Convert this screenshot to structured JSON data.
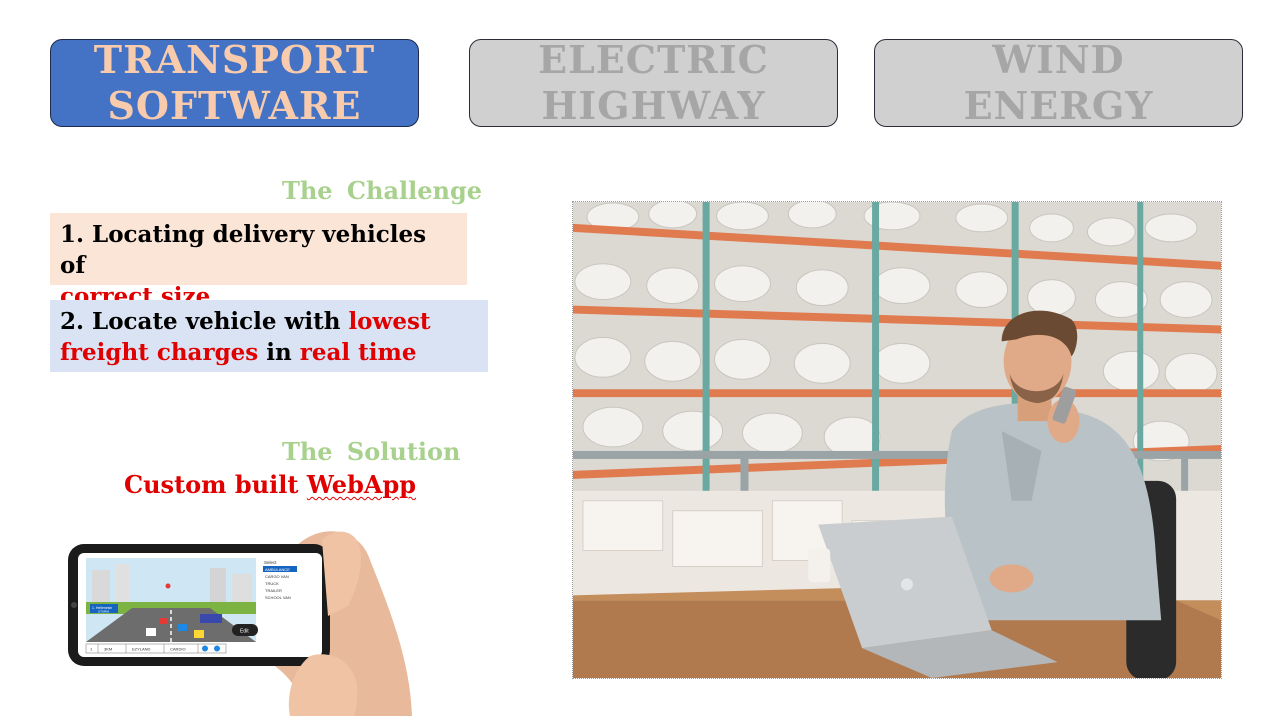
{
  "tabs": [
    {
      "line1": "TRANSPORT",
      "line2": "SOFTWARE",
      "active": true
    },
    {
      "line1": "ELECTRIC",
      "line2": "HIGHWAY",
      "active": false
    },
    {
      "line1": "WIND",
      "line2": "ENERGY",
      "active": false
    }
  ],
  "challenge": {
    "heading": "The  Challenge",
    "item1": {
      "text_black": "1. Locating delivery vehicles of",
      "text_red": "correct size"
    },
    "item2": {
      "text_a": "2. Locate vehicle with ",
      "text_red_a": "lowest",
      "text_red_b": "freight charges",
      "text_b": " in ",
      "text_red_c": "real time"
    }
  },
  "solution": {
    "heading": "The  Solution",
    "text_plain": "Custom built ",
    "text_underlined": "WebApp"
  },
  "phone_screen": {
    "select_label": "Select",
    "options": [
      "AMBULANCE",
      "CARGO VAN",
      "TRUCK",
      "TRAILER",
      "SCHOOL VAN"
    ],
    "sign_label": "1. Hellenesin",
    "sign_sub": "UTURM",
    "edit_button": "Edit",
    "table_cells": [
      "1",
      "3KM",
      "EZYLAND",
      "CARDIO"
    ]
  },
  "colors": {
    "active_tab_bg": "#4472c4",
    "active_tab_text": "#f8cbad",
    "inactive_tab_bg": "#d0d0d0",
    "inactive_tab_text": "#a6a6a6",
    "heading_green": "#a9d18e",
    "highlight_red": "#e00000",
    "box1_bg": "#fbe5d6",
    "box2_bg": "#dae3f3"
  }
}
